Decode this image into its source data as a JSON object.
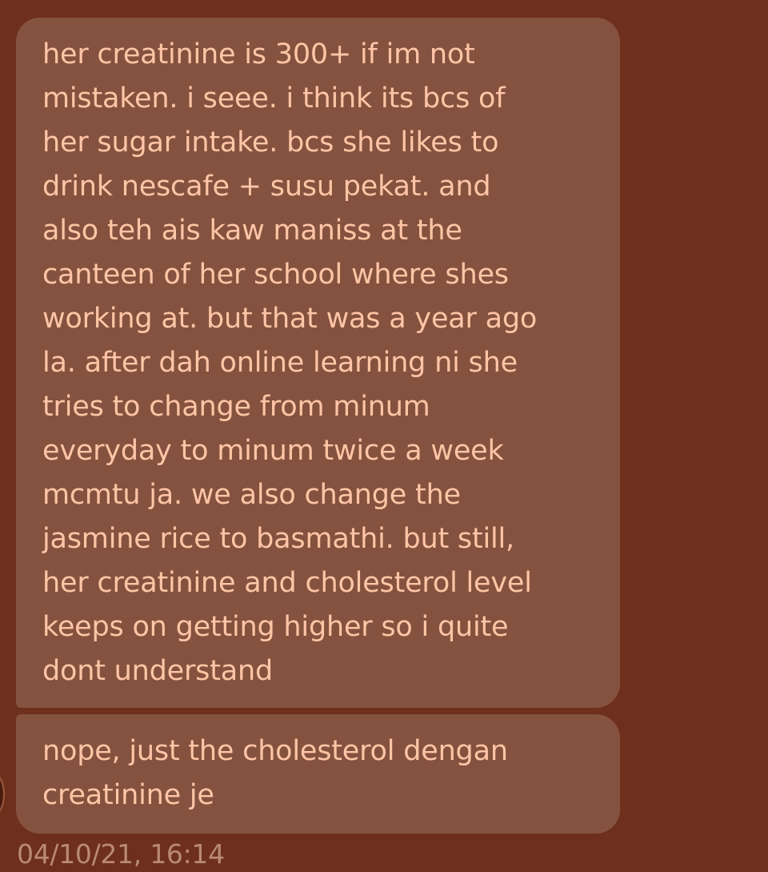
{
  "conversation": {
    "messages": [
      {
        "lines": [
          "her creatinine is 300+ if im not",
          "mistaken. i seee. i think its bcs of",
          "her sugar intake. bcs she likes to",
          "drink nescafe + susu pekat. and",
          "also teh ais kaw maniss at the",
          "canteen of her school where shes",
          "working at. but that was a year ago",
          "la. after dah online learning ni she",
          "tries to change from minum",
          "everyday to minum twice a week",
          "mcmtu ja. we also change the",
          "jasmine rice to basmathi. but still,",
          "her creatinine and cholesterol level",
          "keeps on getting higher so i quite",
          "dont understand"
        ]
      },
      {
        "lines": [
          "nope, just the cholesterol dengan",
          "creatinine je"
        ]
      }
    ],
    "timestamp": "04/10/21, 16:14",
    "avatar_icon": "avatar-icon"
  },
  "colors": {
    "background": "#6e2f1d",
    "bubble": "#85523f",
    "text": "#ffc5a6",
    "timestamp": "#b98a73"
  }
}
